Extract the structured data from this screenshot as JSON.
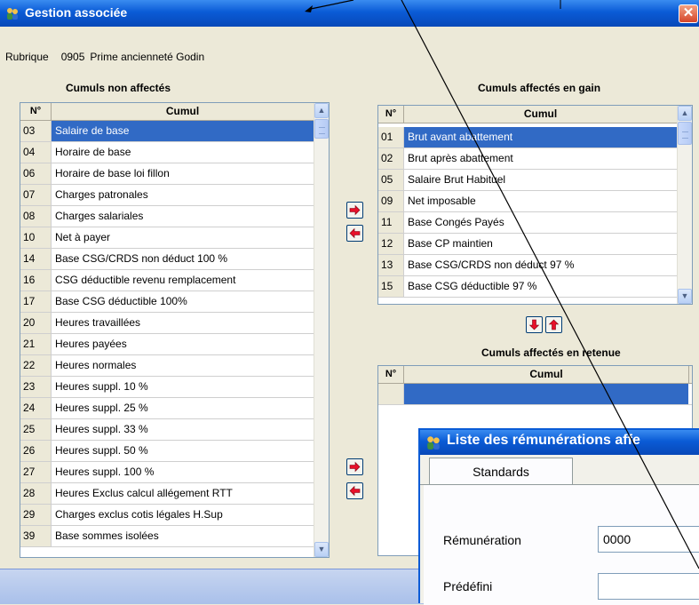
{
  "window": {
    "title": "Gestion associée",
    "close_symbol": "✕"
  },
  "rubrique": {
    "label": "Rubrique",
    "code": "0905",
    "name": "Prime ancienneté Godin"
  },
  "unassigned": {
    "caption": "Cumuls non affectés",
    "col_num": "N°",
    "col_name": "Cumul",
    "rows": [
      {
        "num": "03",
        "name": "Salaire de base",
        "selected": true
      },
      {
        "num": "04",
        "name": "Horaire de base"
      },
      {
        "num": "06",
        "name": "Horaire de base loi fillon"
      },
      {
        "num": "07",
        "name": "Charges patronales"
      },
      {
        "num": "08",
        "name": "Charges salariales"
      },
      {
        "num": "10",
        "name": "Net à payer"
      },
      {
        "num": "14",
        "name": "Base CSG/CRDS non déduct 100 %"
      },
      {
        "num": "16",
        "name": "CSG déductible revenu remplacement"
      },
      {
        "num": "17",
        "name": "Base CSG déductible 100%"
      },
      {
        "num": "20",
        "name": "Heures travaillées"
      },
      {
        "num": "21",
        "name": "Heures payées"
      },
      {
        "num": "22",
        "name": "Heures normales"
      },
      {
        "num": "23",
        "name": "Heures suppl. 10 %"
      },
      {
        "num": "24",
        "name": "Heures suppl. 25 %"
      },
      {
        "num": "25",
        "name": "Heures suppl. 33 %"
      },
      {
        "num": "26",
        "name": "Heures suppl. 50 %"
      },
      {
        "num": "27",
        "name": "Heures suppl. 100 %"
      },
      {
        "num": "28",
        "name": "Heures Exclus calcul allégement RTT"
      },
      {
        "num": "29",
        "name": "Charges exclus cotis légales H.Sup"
      },
      {
        "num": "39",
        "name": "Base sommes isolées"
      }
    ]
  },
  "gain": {
    "caption": "Cumuls affectés en gain",
    "col_num": "N°",
    "col_name": "Cumul",
    "rows": [
      {
        "num": "01",
        "name": "Brut avant abattement",
        "selected": true
      },
      {
        "num": "02",
        "name": "Brut après abattement"
      },
      {
        "num": "05",
        "name": "Salaire Brut Habituel"
      },
      {
        "num": "09",
        "name": "Net imposable"
      },
      {
        "num": "11",
        "name": "Base Congés Payés"
      },
      {
        "num": "12",
        "name": "Base CP maintien"
      },
      {
        "num": "13",
        "name": "Base CSG/CRDS non déduct 97 %"
      },
      {
        "num": "15",
        "name": "Base CSG déductible 97 %"
      }
    ]
  },
  "retenue": {
    "caption": "Cumuls affectés en retenue",
    "col_num": "N°",
    "col_name": "Cumul"
  },
  "dialog": {
    "title": "Liste des rémunérations affe",
    "tab": "Standards",
    "remuneration_label": "Rémunération",
    "remuneration_value": "0000",
    "predefini_label": "Prédéfini",
    "predefini_value": ""
  },
  "colors": {
    "title_blue": "#0a5bd6",
    "selection": "#316ac5",
    "arrow_red": "#e8102a",
    "face": "#ece9d8"
  },
  "icons": [
    "app-icon",
    "close-icon",
    "arrow-right-icon",
    "arrow-left-icon",
    "arrow-down-icon",
    "arrow-up-icon",
    "scroll-up-icon",
    "scroll-down-icon"
  ]
}
